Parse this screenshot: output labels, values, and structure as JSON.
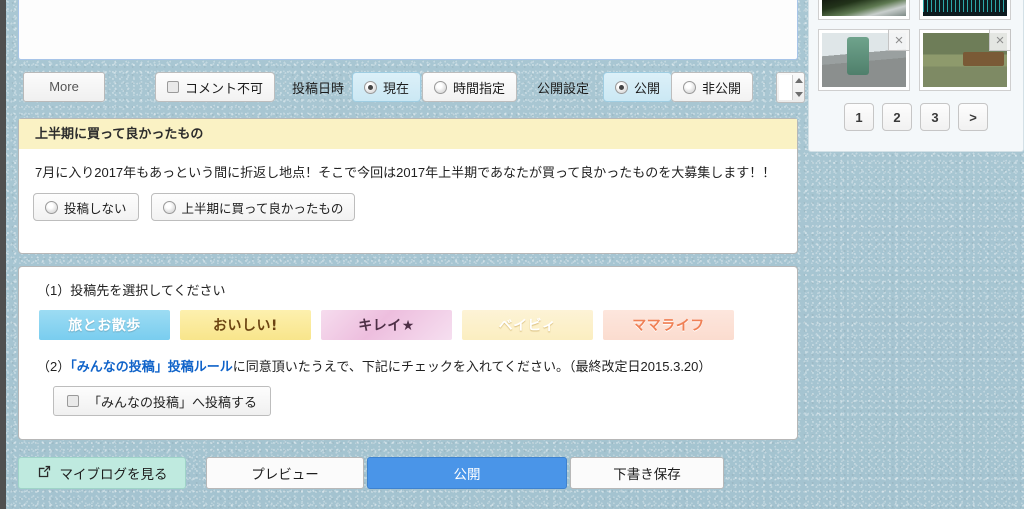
{
  "toolbar": {
    "more_label": "More",
    "comment_disable_label": "コメント不可",
    "post_datetime_label": "投稿日時",
    "datetime_now_label": "現在",
    "datetime_scheduled_label": "時間指定",
    "publish_setting_label": "公開設定",
    "publish_public_label": "公開",
    "publish_private_label": "非公開",
    "spinner_value": ""
  },
  "campaign": {
    "title": "上半期に買って良かったもの",
    "body": "7月に入り2017年もあっという間に折返し地点！そこで今回は2017年上半期であなたが買って良かったものを大募集します！！",
    "option_none_label": "投稿しない",
    "option_join_label": "上半期に買って良かったもの"
  },
  "post_target": {
    "step1_label": "（1）投稿先を選択してください",
    "banners": [
      {
        "label": "旅とお散歩",
        "color": "#79cdef"
      },
      {
        "label": "おいしい!",
        "color": "#f8e58b"
      },
      {
        "label": "キレイ★",
        "color": "#edbede"
      },
      {
        "label": "ベイビィ",
        "color": "#fbeec0"
      },
      {
        "label": "ママライフ",
        "color": "#fbdccf"
      }
    ],
    "step2_prefix": "（2）",
    "step2_link": "「みんなの投稿」投稿ルール",
    "step2_suffix": "に同意頂いたうえで、下記にチェックを入れてください。（最終改定日2015.3.20）",
    "agree_checkbox_label": "「みんなの投稿」へ投稿する"
  },
  "bottom_bar": {
    "myblog_label": "マイブログを見る",
    "preview_label": "プレビュー",
    "publish_label": "公開",
    "draft_label": "下書き保存",
    "publish_color": "#4a95e8",
    "myblog_color": "#bfeadf"
  },
  "sidebar": {
    "thumbnails": [
      {
        "remove_label": "×"
      },
      {
        "remove_label": "×"
      },
      {
        "remove_label": "×"
      },
      {
        "remove_label": "×"
      }
    ],
    "pager": [
      "1",
      "2",
      "3",
      ">"
    ]
  }
}
